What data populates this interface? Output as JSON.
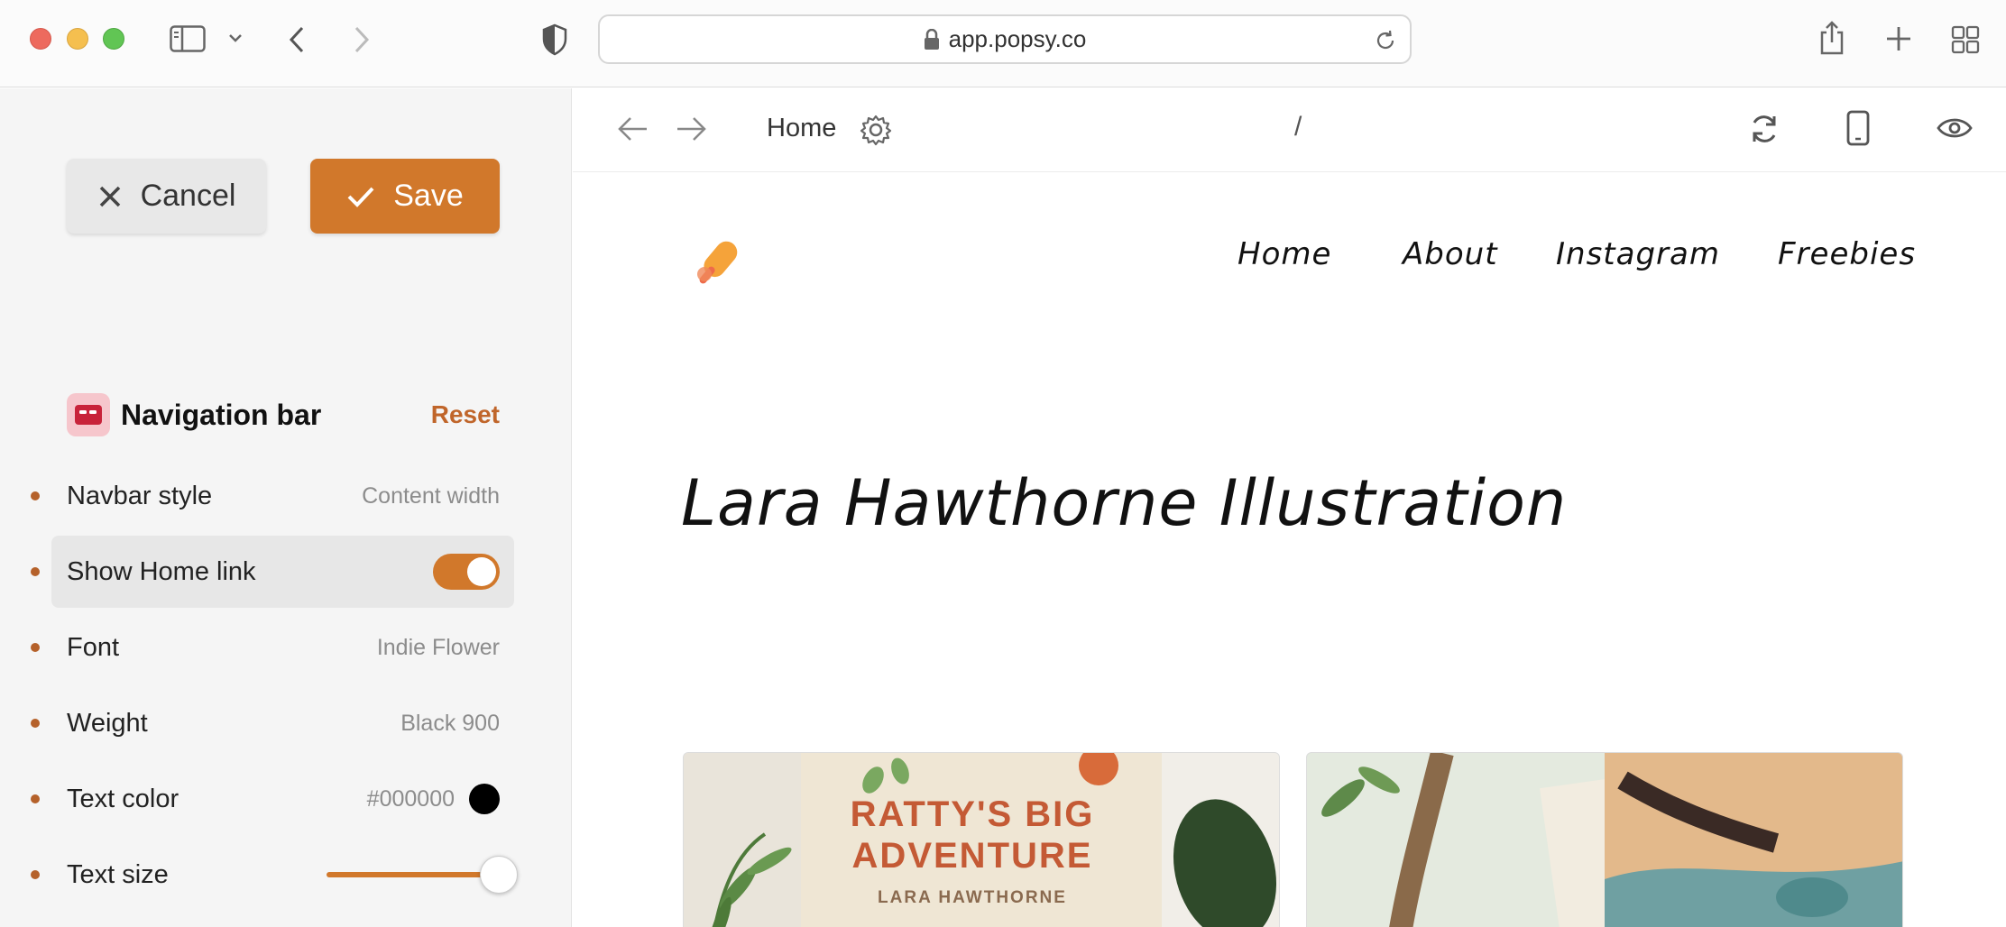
{
  "browser": {
    "url": "app.popsy.co"
  },
  "sidebar": {
    "cancel_label": "Cancel",
    "save_label": "Save",
    "section_title": "Navigation bar",
    "reset_label": "Reset",
    "rows": [
      {
        "label": "Navbar style",
        "value": "Content width"
      },
      {
        "label": "Show Home link",
        "toggle_on": true
      },
      {
        "label": "Font",
        "value": "Indie Flower"
      },
      {
        "label": "Weight",
        "value": "Black 900"
      },
      {
        "label": "Text color",
        "value": "#000000",
        "swatch": "#000000"
      },
      {
        "label": "Text size",
        "slider_fraction": 0.9
      }
    ],
    "accent_color": "#d1782b"
  },
  "preview": {
    "page_name": "Home",
    "path": "/"
  },
  "site": {
    "nav": [
      "Home",
      "About",
      "Instagram",
      "Freebies"
    ],
    "title": "Lara Hawthorne Illustration",
    "cards": [
      {
        "book_title": "RATTY'S BIG ADVENTURE",
        "book_author": "LARA HAWTHORNE"
      }
    ]
  }
}
